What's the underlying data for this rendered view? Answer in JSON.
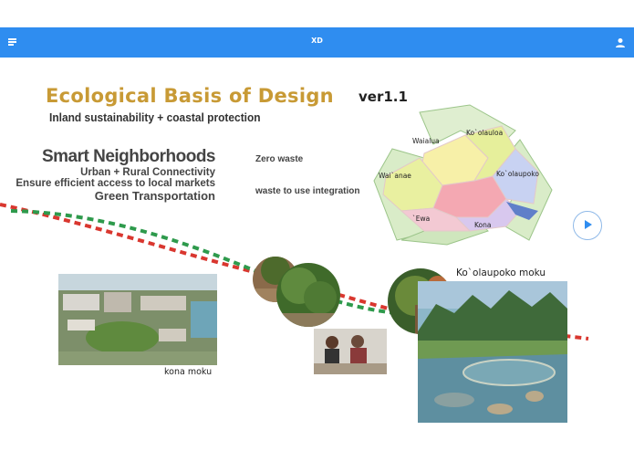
{
  "topbar": {
    "title": "XD",
    "menu_icon": "menu-icon",
    "user_icon": "user-icon",
    "color": "#2f8df0"
  },
  "slide": {
    "title": "Ecological Basis of Design",
    "version": "ver1.1",
    "subtitle": "Inland sustainability + coastal protection",
    "smart": {
      "heading": "Smart Neighborhoods",
      "line1": "Urban + Rural Connectivity",
      "line2": "Ensure efficient access to local markets",
      "line3": "Green Transportation"
    },
    "zero_waste": "Zero waste",
    "waste_integration": "waste to use integration",
    "map_labels": {
      "waialua": "Waialua",
      "koolauloa": "Ko`olauloa",
      "waianae": "Wai`anae",
      "koolaupoko": "Ko`olaupoko",
      "ewa": "`Ewa",
      "kona": "Kona"
    },
    "caption_kona": "kona moku",
    "caption_koolaupoko": "Ko`olaupoko moku",
    "play_icon": "play-icon",
    "title_color": "#c89a35"
  }
}
